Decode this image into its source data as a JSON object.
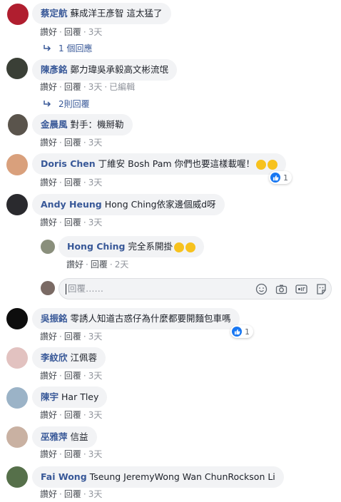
{
  "comments": [
    {
      "name": "蔡定航",
      "text": "蘇成洋王彥智 這太猛了",
      "like": "讚好",
      "reply": "回覆",
      "time": "3天"
    },
    {
      "name": "陳彥銘",
      "text": "鄭力瑋吳承毅高文彬流氓",
      "like": "讚好",
      "reply": "回覆",
      "time": "3天",
      "edited": "已編輯"
    },
    {
      "name": "金晨風",
      "text": "對手：機掰勒",
      "like": "讚好",
      "reply": "回覆",
      "time": "3天"
    },
    {
      "name": "Doris Chen",
      "text": "丁維安 Bosh Pam 你們也要這樣載喔！",
      "like": "讚好",
      "reply": "回覆",
      "time": "3天",
      "reactions": "1"
    },
    {
      "name": "Andy Heung",
      "text": "Hong Ching依家邊個威d呀",
      "like": "讚好",
      "reply": "回覆",
      "time": "3天"
    },
    {
      "name": "吳振銘",
      "text": "零誘人知道古惑仔為什麼都要開麵包車嗎",
      "like": "讚好",
      "reply": "回覆",
      "time": "3天",
      "reactions": "1"
    },
    {
      "name": "李紋欣",
      "text": "江佩蓉",
      "like": "讚好",
      "reply": "回覆",
      "time": "3天"
    },
    {
      "name": "陳宇",
      "text": "Har Tley",
      "like": "讚好",
      "reply": "回覆",
      "time": "3天"
    },
    {
      "name": "巫雅萍",
      "text": "信益",
      "like": "讚好",
      "reply": "回覆",
      "time": "3天"
    },
    {
      "name": "Fai Wong",
      "text": "Tseung JeremyWong Wan ChunRockson Li",
      "like": "讚好",
      "reply": "回覆",
      "time": "3天"
    }
  ],
  "reply_links": [
    "1 個回應",
    "2則回覆"
  ],
  "nested_reply": {
    "name": "Hong Ching",
    "text": "完全系開掛",
    "like": "讚好",
    "reply": "回覆",
    "time": "2天"
  },
  "reply_input": {
    "placeholder": "回覆……"
  },
  "icons": {
    "reply_arrow": "reply-arrow-icon",
    "emoji": "emoji-icon",
    "camera": "camera-icon",
    "gif": "gif-icon",
    "sticker": "sticker-icon",
    "like_reaction": "like-reaction-icon"
  },
  "colors": {
    "name": "#385898",
    "bubble": "#f2f3f5",
    "meta": "#90949c",
    "like_blue": "#1877f2"
  }
}
